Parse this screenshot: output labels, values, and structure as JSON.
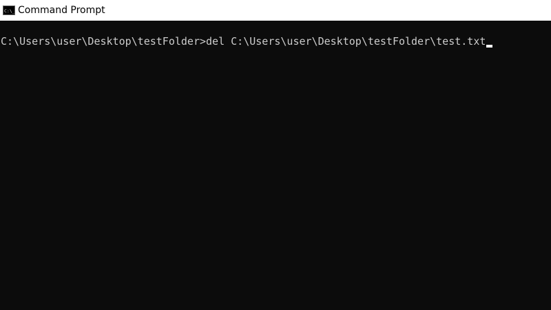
{
  "window": {
    "title": "Command Prompt",
    "icon": "command-prompt-icon"
  },
  "console": {
    "prompt": "C:\\Users\\user\\Desktop\\testFolder>",
    "command": "del C:\\Users\\user\\Desktop\\testFolder\\test.txt"
  },
  "colors": {
    "titlebar_background": "#ffffff",
    "console_background": "#0c0c0c",
    "console_text": "#cccccc",
    "cursor": "#ffffff"
  }
}
